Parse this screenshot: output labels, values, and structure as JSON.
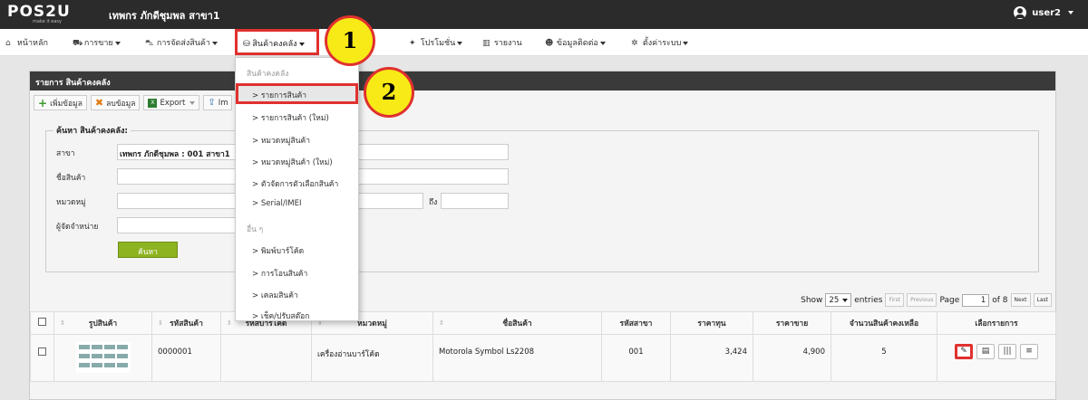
{
  "header": {
    "logo_main": "POS2U",
    "logo_sub": "make it easy",
    "store_name": "เทพกร ภักดีชุมพล สาขา1",
    "user": "user2"
  },
  "nav": {
    "home": "หน้าหลัก",
    "sales": "การขาย",
    "delivery": "การจัดส่งสินค้า",
    "stock": "สินค้าคงคลัง",
    "promotion": "โปรโมชั่น",
    "report": "รายงาน",
    "contacts": "ข้อมูลติดต่อ",
    "settings": "ตั้งค่าระบบ"
  },
  "dropdown": {
    "header_stock": "สินค้าคงคลัง",
    "items": [
      "> รายการสินค้า",
      "> รายการสินค้า (ใหม่)",
      "> หมวดหมู่สินค้า",
      "> หมวดหมู่สินค้า (ใหม่)",
      "> ตัวจัดการตัวเลือกสินค้า",
      "> Serial/IMEI"
    ],
    "header_other": "อื่น ๆ",
    "other_items": [
      "> พิมพ์บาร์โค้ด",
      "> การโอนสินค้า",
      "> เคลมสินค้า",
      "> เช็ค/ปรับสต๊อก"
    ]
  },
  "callouts": [
    "1",
    "2"
  ],
  "panel": {
    "title": "รายการ สินค้าคงคลัง",
    "toolbar": {
      "add": "เพิ่มข้อมูล",
      "delete": "ลบข้อมูล",
      "export": "Export",
      "import": "Im"
    }
  },
  "search": {
    "legend": "ค้นหา สินค้าคงคลัง:",
    "branch_label": "สาขา",
    "branch_value": "เทพกร ภักดีชุมพล : 001 สาขา1",
    "name_label": "ชื่อสินค้า",
    "category_label": "หมวดหมู่",
    "to_label": "ถึง",
    "supplier_label": "ผู้จัดจำหน่าย",
    "button": "ค้นหา"
  },
  "paging": {
    "show": "Show",
    "entries_value": "25",
    "entries": "entries",
    "first": "First",
    "previous": "Previous",
    "page": "Page",
    "page_value": "1",
    "of": "of 8",
    "next": "Next",
    "last": "Last"
  },
  "table": {
    "columns": [
      "รูปสินค้า",
      "รหัสสินค้า",
      "รหัสบาร์โค้ด",
      "หมวดหมู่",
      "ชื่อสินค้า",
      "รหัสสาขา",
      "ราคาทุน",
      "ราคาขาย",
      "จำนวนสินค้าคงเหลือ",
      "เลือกรายการ"
    ],
    "rows": [
      {
        "code": "0000001",
        "barcode": "",
        "category": "เครื่องอ่านบาร์โค้ด",
        "name": "Motorola Symbol Ls2208",
        "branch": "001",
        "cost": "3,424",
        "price": "4,900",
        "qty": "5"
      }
    ]
  },
  "colors": {
    "accent_red": "#e0312f",
    "callout_yellow": "#f8ea16",
    "search_green": "#8db320",
    "topbar": "#2b2b2b"
  }
}
